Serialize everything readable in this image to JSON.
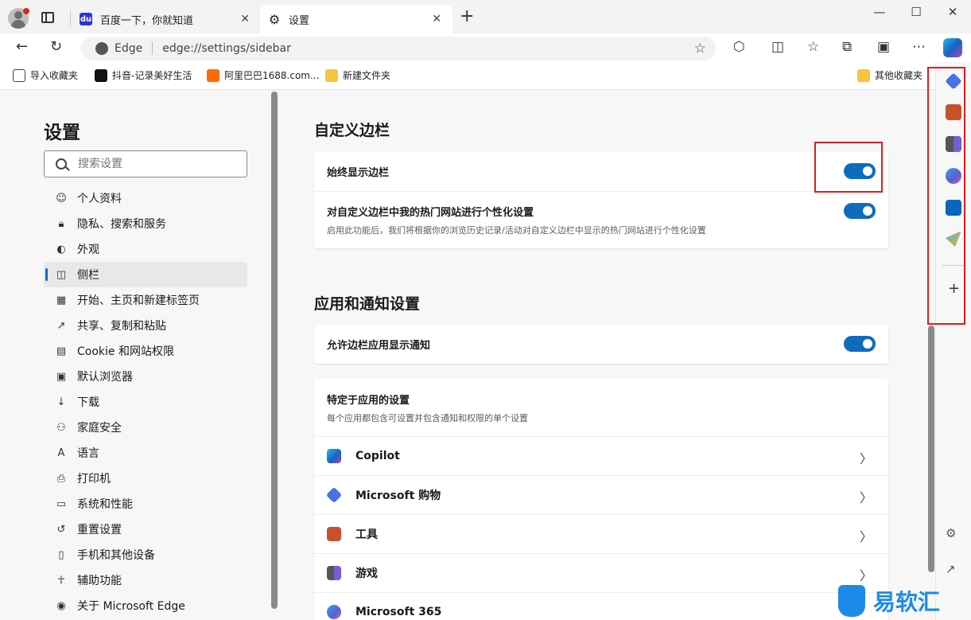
{
  "tabs": [
    {
      "title": "百度一下，你就知道",
      "favicon": "baidu-paw-icon"
    },
    {
      "title": "设置",
      "favicon": "gear-icon"
    }
  ],
  "window_controls": {
    "minimize": "—",
    "maximize": "☐",
    "close": "✕"
  },
  "address_bar": {
    "site_label": "Edge",
    "url": "edge://settings/sidebar"
  },
  "bookmarks": [
    {
      "label": "导入收藏夹",
      "icon": "import-favorites-icon"
    },
    {
      "label": "抖音-记录美好生活",
      "icon": "tiktok-icon"
    },
    {
      "label": "阿里巴巴1688.com...",
      "icon": "1688-icon"
    },
    {
      "label": "新建文件夹",
      "icon": "folder-icon"
    }
  ],
  "other_bookmarks": "其他收藏夹",
  "settings": {
    "title": "设置",
    "search_placeholder": "搜索设置",
    "nav": [
      {
        "label": "个人资料",
        "icon": "profile-icon"
      },
      {
        "label": "隐私、搜索和服务",
        "icon": "lock-icon"
      },
      {
        "label": "外观",
        "icon": "palette-icon"
      },
      {
        "label": "侧栏",
        "icon": "sidebar-icon",
        "active": true
      },
      {
        "label": "开始、主页和新建标签页",
        "icon": "home-icon"
      },
      {
        "label": "共享、复制和粘贴",
        "icon": "share-icon"
      },
      {
        "label": "Cookie 和网站权限",
        "icon": "cookie-icon"
      },
      {
        "label": "默认浏览器",
        "icon": "browser-icon"
      },
      {
        "label": "下载",
        "icon": "download-icon"
      },
      {
        "label": "家庭安全",
        "icon": "family-icon"
      },
      {
        "label": "语言",
        "icon": "language-icon"
      },
      {
        "label": "打印机",
        "icon": "printer-icon"
      },
      {
        "label": "系统和性能",
        "icon": "system-icon"
      },
      {
        "label": "重置设置",
        "icon": "reset-icon"
      },
      {
        "label": "手机和其他设备",
        "icon": "phone-icon"
      },
      {
        "label": "辅助功能",
        "icon": "accessibility-icon"
      },
      {
        "label": "关于 Microsoft Edge",
        "icon": "edge-icon"
      }
    ]
  },
  "customize_section": {
    "title": "自定义边栏",
    "always_show": {
      "label": "始终显示边栏",
      "enabled": true
    },
    "personalize": {
      "label": "对自定义边栏中我的热门网站进行个性化设置",
      "description": "启用此功能后，我们将根据你的浏览历史记录/活动对自定义边栏中显示的热门网站进行个性化设置",
      "enabled": true
    }
  },
  "apps_section": {
    "title": "应用和通知设置",
    "allow_notifications": {
      "label": "允许边栏应用显示通知",
      "enabled": true
    },
    "app_specific": {
      "title": "特定于应用的设置",
      "description": "每个应用都包含可设置并包含通知和权限的单个设置",
      "apps": [
        {
          "label": "Copilot",
          "icon": "copilot-icon",
          "color": "#2a9df4"
        },
        {
          "label": "Microsoft 购物",
          "icon": "shopping-tag-icon",
          "color": "#4a6fe8"
        },
        {
          "label": "工具",
          "icon": "toolbox-icon",
          "color": "#c8502b"
        },
        {
          "label": "游戏",
          "icon": "game-chess-icon",
          "color": "#7b5bd6"
        },
        {
          "label": "Microsoft 365",
          "icon": "microsoft-365-icon",
          "color": "#5b5fc7"
        }
      ]
    }
  },
  "colors": {
    "accent": "#0f6cbd",
    "highlight_box": "#e01b1b",
    "watermark": "#1d8ae8"
  },
  "watermark": "易软汇"
}
